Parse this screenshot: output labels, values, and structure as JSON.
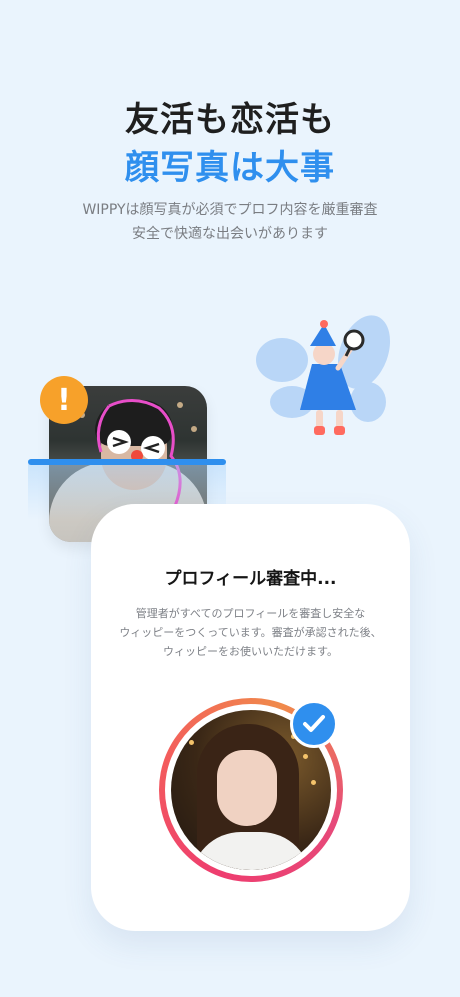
{
  "headline": {
    "line1": "友活も恋活も",
    "line2": "顔写真は大事"
  },
  "subtitle": {
    "line1": "WIPPYは顔写真が必須でプロフ内容を厳重審査",
    "line2": "安全で快適な出会いがあります"
  },
  "card": {
    "title": "プロフィール審査中...",
    "body_line1": "管理者がすべてのプロフィールを審査し安全な",
    "body_line2": "ウィッピーをつくっています。審査が承認された後、",
    "body_line3": "ウィッピーをお使いいただけます。"
  },
  "badges": {
    "warning_symbol": "!",
    "warning_icon": "exclamation-icon",
    "approved_icon": "checkmark-icon"
  },
  "colors": {
    "background": "#eaf4fd",
    "accent_blue": "#2f8fee",
    "warning_orange": "#f7a12a",
    "ring_pink": "#ee3d6f"
  }
}
